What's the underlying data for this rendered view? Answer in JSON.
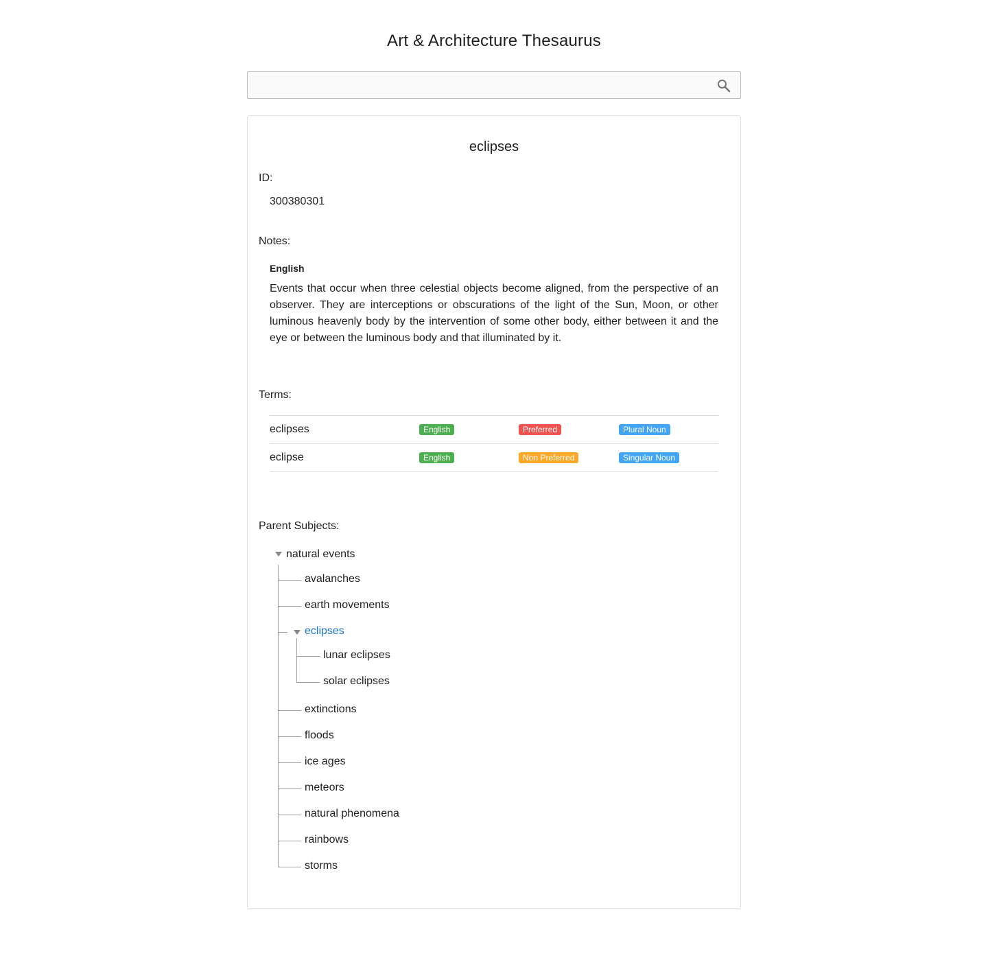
{
  "app": {
    "title": "Art & Architecture Thesaurus"
  },
  "search": {
    "placeholder": "",
    "value": "",
    "icon": "search-icon"
  },
  "subject": {
    "title": "eclipses",
    "id_label": "ID:",
    "id_value": "300380301",
    "notes_label": "Notes:",
    "notes": [
      {
        "language": "English",
        "text": "Events that occur when three celestial objects become aligned, from the perspective of an observer. They are interceptions or obscurations of the light of the Sun, Moon, or other luminous heavenly body by the intervention of some other body, either between it and the eye or between the luminous body and that illuminated by it."
      }
    ],
    "terms_label": "Terms:",
    "terms": [
      {
        "term": "eclipses",
        "language": "English",
        "preference": "Preferred",
        "part_of_speech": "Plural Noun"
      },
      {
        "term": "eclipse",
        "language": "English",
        "preference": "Non Preferred",
        "part_of_speech": "Singular Noun"
      }
    ],
    "badge_colors": {
      "language": "#4caf50",
      "preferred": "#ef5350",
      "non_preferred": "#ffa726",
      "part_of_speech": "#42a5f5"
    },
    "parents_label": "Parent Subjects:",
    "parent_tree": {
      "root": "natural events",
      "children": [
        "avalanches",
        "earth movements",
        "eclipses",
        "extinctions",
        "floods",
        "ice ages",
        "meteors",
        "natural phenomena",
        "rainbows",
        "storms"
      ],
      "expanded_child": "eclipses",
      "expanded_children": [
        "lunar eclipses",
        "solar eclipses"
      ],
      "active_color": "#1976d2"
    }
  }
}
